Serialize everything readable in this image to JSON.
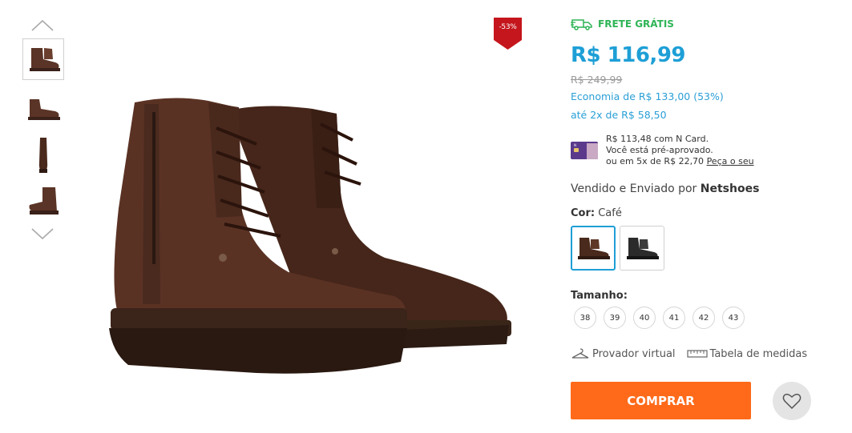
{
  "gallery": {
    "thumbnails": [
      {
        "name": "side view",
        "active": true
      },
      {
        "name": "profile view",
        "active": false
      },
      {
        "name": "front view",
        "active": false
      },
      {
        "name": "back view",
        "active": false
      }
    ],
    "discount_label": "-53%"
  },
  "product": {
    "shipping_label": "FRETE GRÁTIS",
    "price": "R$ 116,99",
    "old_price": "R$ 249,99",
    "economy": "Economia de R$ 133,00 (53%)",
    "installments": "até 2x de R$ 58,50",
    "ncard": {
      "line1": "R$ 113,48 com N Card.",
      "line2": "Você está pré-aprovado.",
      "line3": "ou em 5x de R$ 22,70",
      "link": "Peça o seu"
    },
    "seller_prefix": "Vendido e Enviado por",
    "seller_name": "Netshoes",
    "color_label": "Cor:",
    "color_value": "Café",
    "colors": [
      {
        "name": "Café",
        "hex": "#4a2a1c",
        "active": true
      },
      {
        "name": "Preto",
        "hex": "#2b2b2b",
        "active": false
      }
    ],
    "size_label": "Tamanho:",
    "sizes": [
      "38",
      "39",
      "40",
      "41",
      "42",
      "43"
    ],
    "virtual_fitting": "Provador virtual",
    "size_chart": "Tabela de medidas",
    "buy_label": "COMPRAR"
  },
  "colors": {
    "brand_price": "#1e9fd6",
    "free_shipping": "#2fb456",
    "buy_button": "#ff6a1a",
    "discount_badge": "#c4161c"
  },
  "icons": [
    "chevron-up-icon",
    "chevron-down-icon",
    "truck-icon",
    "card-icon",
    "hanger-icon",
    "ruler-icon",
    "heart-icon"
  ]
}
